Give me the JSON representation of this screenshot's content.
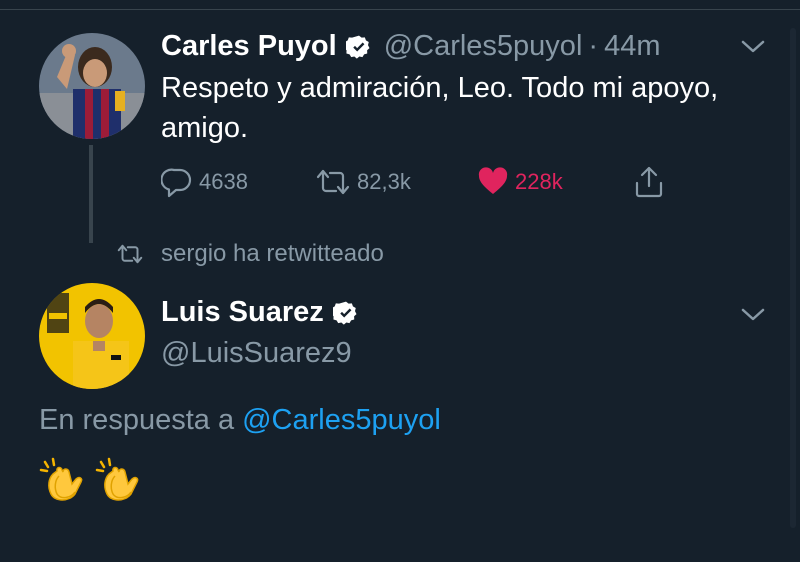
{
  "tweet1": {
    "name": "Carles Puyol",
    "handle": "@Carles5puyol",
    "separator": "·",
    "time": "44m",
    "text": "Respeto y admiración, Leo. Todo mi apoyo, amigo.",
    "replies": "4638",
    "retweets": "82,3k",
    "likes": "228k",
    "liked": true
  },
  "retweet_context": {
    "text": "sergio ha retwitteado"
  },
  "tweet2": {
    "name": "Luis Suarez",
    "handle": "@LuisSuarez9",
    "reply_prefix": "En respuesta a",
    "reply_mention": "@Carles5puyol",
    "emoji": [
      "👏",
      "👏"
    ]
  },
  "colors": {
    "background": "#15202b",
    "secondary_text": "#8899a6",
    "link": "#1da1f2",
    "like": "#e0245e"
  },
  "icons": {
    "verified": "verified-badge-icon",
    "more": "chevron-down-icon",
    "reply": "reply-icon",
    "retweet": "retweet-icon",
    "like": "heart-icon",
    "share": "share-icon",
    "clap": "clapping-hands-icon"
  }
}
